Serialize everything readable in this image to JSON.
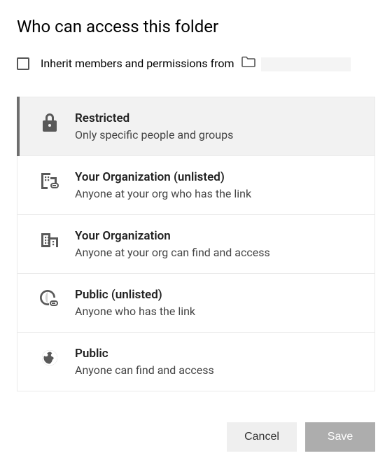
{
  "title": "Who can access this folder",
  "inherit": {
    "label": "Inherit members and permissions from",
    "checked": false
  },
  "options": [
    {
      "icon": "lock-icon",
      "title": "Restricted",
      "desc": "Only specific people and groups",
      "selected": true
    },
    {
      "icon": "domain-link-icon",
      "title": "Your Organization (unlisted)",
      "desc": "Anyone at your org who has the link",
      "selected": false
    },
    {
      "icon": "domain-icon",
      "title": "Your Organization",
      "desc": "Anyone at your org can find and access",
      "selected": false
    },
    {
      "icon": "globe-link-icon",
      "title": "Public (unlisted)",
      "desc": "Anyone who has the link",
      "selected": false
    },
    {
      "icon": "globe-icon",
      "title": "Public",
      "desc": "Anyone can find and access",
      "selected": false
    }
  ],
  "buttons": {
    "cancel": "Cancel",
    "save": "Save"
  }
}
